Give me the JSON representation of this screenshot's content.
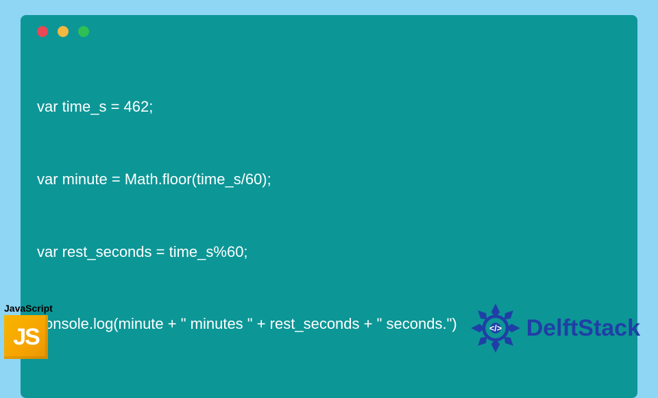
{
  "code_block": {
    "window_dots": [
      "red",
      "yellow",
      "green"
    ],
    "lines": [
      "var time_s = 462;",
      "var minute = Math.floor(time_s/60);",
      "var rest_seconds = time_s%60;",
      "console.log(minute + \" minutes \" + rest_seconds + \" seconds.\")"
    ]
  },
  "js_badge": {
    "label": "JavaScript",
    "logo_text": "JS"
  },
  "brand": {
    "name": "DelftStack",
    "icon": "gear-diamond-icon",
    "color": "#1f3fa6"
  },
  "colors": {
    "page_bg": "#8fd5f4",
    "card_bg": "#0d9696",
    "code_text": "#ffffff"
  }
}
